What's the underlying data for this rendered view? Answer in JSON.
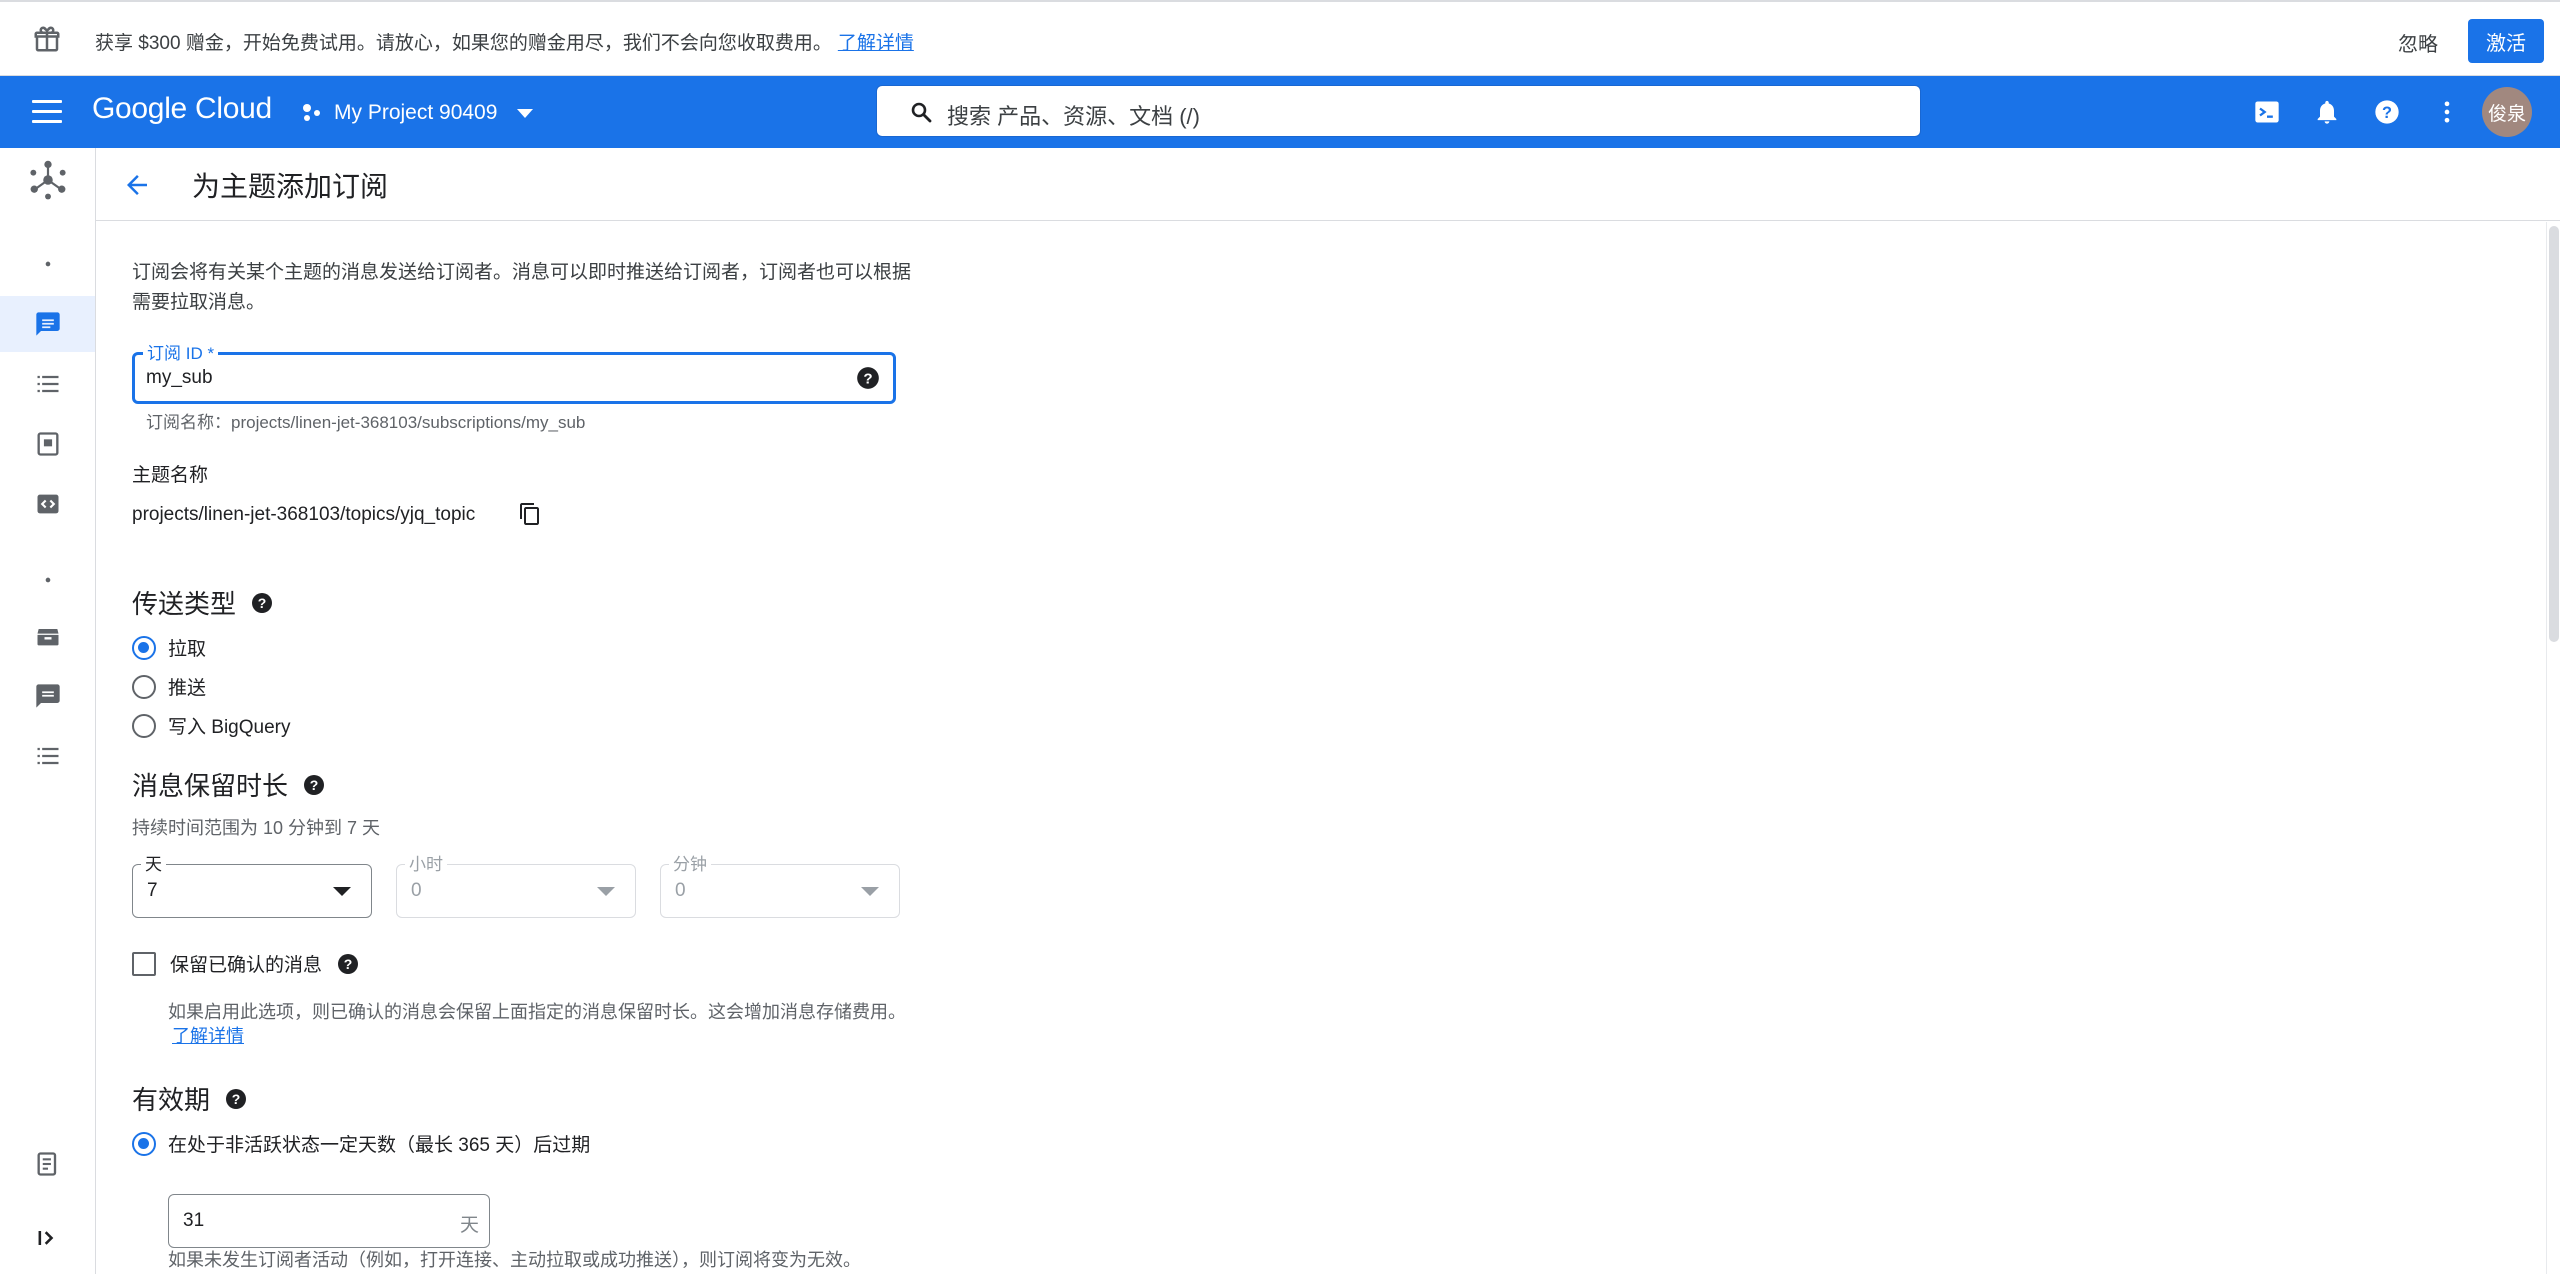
{
  "promo": {
    "text": "获享 $300 赠金，开始免费试用。请放心，如果您的赠金用尽，我们不会向您收取费用。",
    "link": "了解详情",
    "dismiss": "忽略",
    "activate": "激活"
  },
  "header": {
    "logo": "Google Cloud",
    "project": "My Project 90409",
    "search_placeholder": "搜索  产品、资源、文档 (/)",
    "avatar": "俊泉"
  },
  "page": {
    "title": "为主题添加订阅",
    "description": "订阅会将有关某个主题的消息发送给订阅者。消息可以即时推送给订阅者，订阅者也可以根据需要拉取消息。"
  },
  "subscription_id": {
    "label": "订阅 ID *",
    "value": "my_sub",
    "hint": "订阅名称：projects/linen-jet-368103/subscriptions/my_sub"
  },
  "topic": {
    "label": "主题名称",
    "value": "projects/linen-jet-368103/topics/yjq_topic"
  },
  "delivery": {
    "title": "传送类型",
    "options": [
      "拉取",
      "推送",
      "写入 BigQuery"
    ],
    "selected": 0
  },
  "retention": {
    "title": "消息保留时长",
    "subtitle": "持续时间范围为 10 分钟到 7 天",
    "days": {
      "label": "天",
      "value": "7"
    },
    "hours": {
      "label": "小时",
      "value": "0"
    },
    "minutes": {
      "label": "分钟",
      "value": "0"
    },
    "retain_acked_label": "保留已确认的消息",
    "retain_acked_checked": false,
    "note": "如果启用此选项，则已确认的消息会保留上面指定的消息保留时长。这会增加消息存储费用。",
    "note_link": "了解详情"
  },
  "expiration": {
    "title": "有效期",
    "option": "在处于非活跃状态一定天数（最长 365 天）后过期",
    "days_value": "31",
    "days_unit": "天",
    "note": "如果未发生订阅者活动（例如，打开连接、主动拉取或成功推送），则订阅将变为无效。"
  },
  "colors": {
    "brand_blue": "#1a73e8",
    "text": "#202124",
    "secondary_text": "#5f6368"
  }
}
